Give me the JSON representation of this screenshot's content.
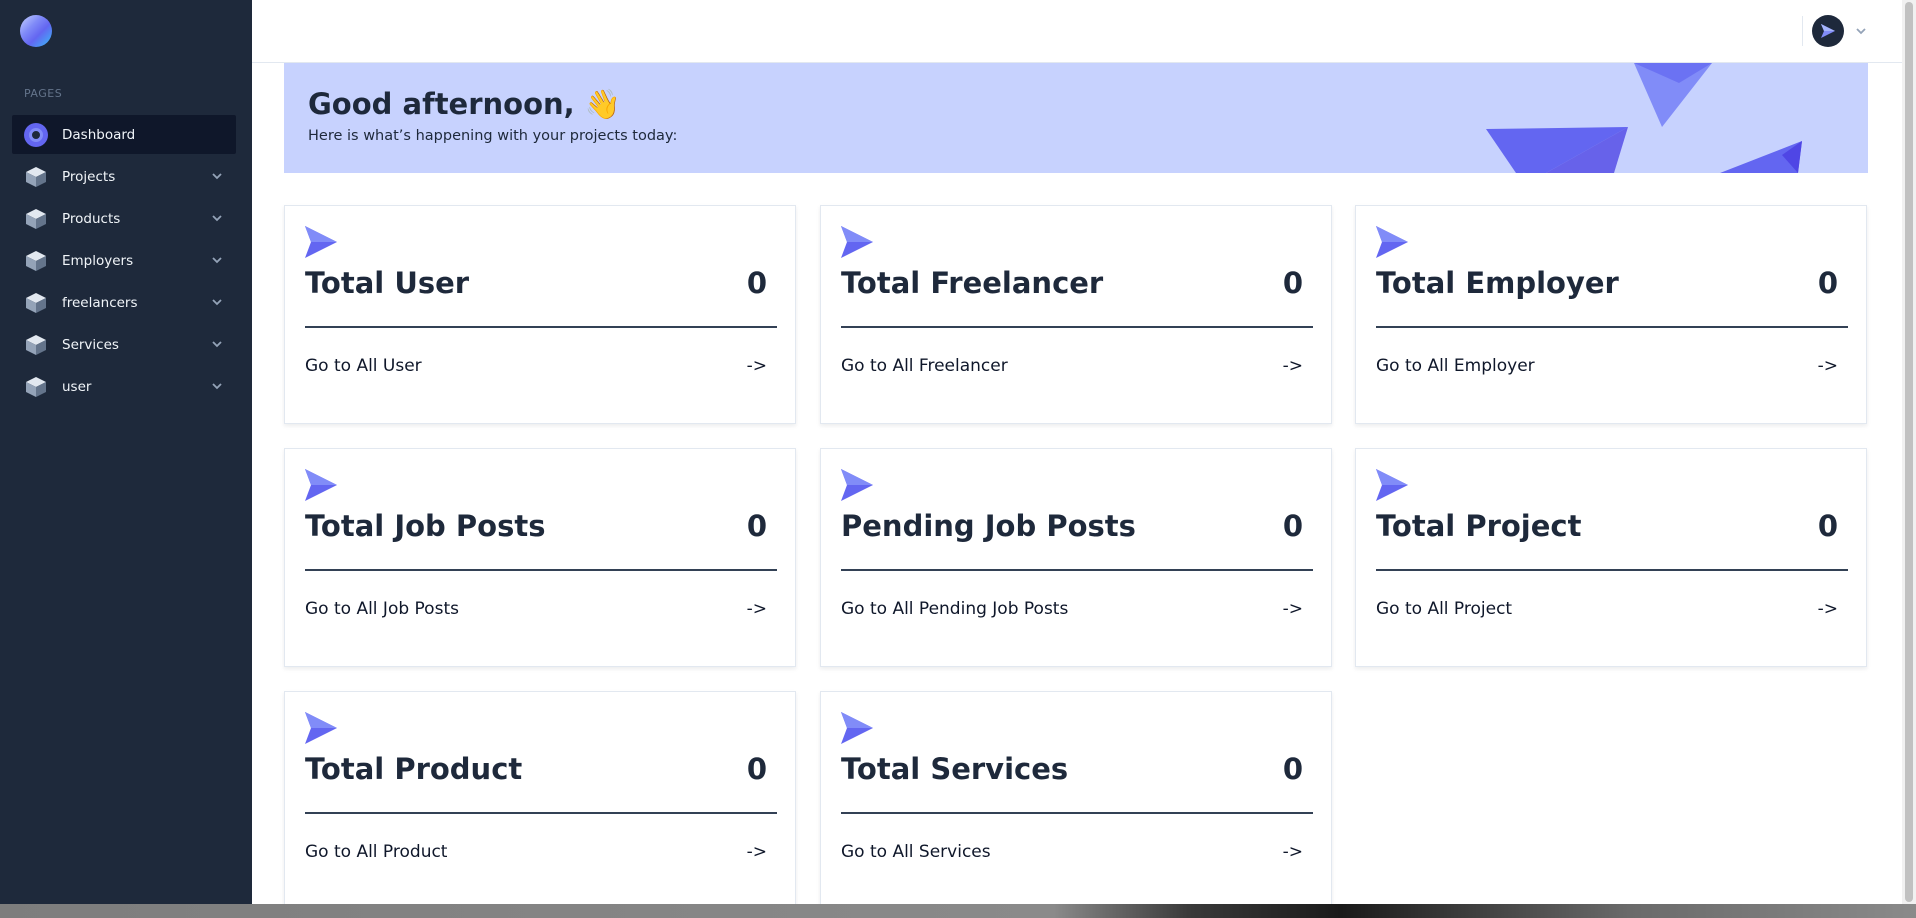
{
  "sidebar": {
    "section_label": "PAGES",
    "items": [
      {
        "label": "Dashboard",
        "icon": "dashboard-icon",
        "active": true
      },
      {
        "label": "Projects",
        "icon": "cube-icon",
        "expandable": true
      },
      {
        "label": "Products",
        "icon": "cube-icon",
        "expandable": true
      },
      {
        "label": "Employers",
        "icon": "cube-icon",
        "expandable": true
      },
      {
        "label": "freelancers",
        "icon": "cube-icon",
        "expandable": true
      },
      {
        "label": "Services",
        "icon": "cube-icon",
        "expandable": true
      },
      {
        "label": "user",
        "icon": "cube-icon",
        "expandable": true
      }
    ]
  },
  "header": {
    "avatar_icon": "paper-plane-icon"
  },
  "banner": {
    "greeting": "Good afternoon, 👋",
    "subtitle": "Here is what’s happening with your projects today:"
  },
  "cards": [
    {
      "title": "Total User",
      "value": "0",
      "link": "Go to All User",
      "arrow": "->"
    },
    {
      "title": "Total Freelancer",
      "value": "0",
      "link": "Go to All Freelancer",
      "arrow": "->"
    },
    {
      "title": "Total Employer",
      "value": "0",
      "link": "Go to All Employer",
      "arrow": "->"
    },
    {
      "title": "Total Job Posts",
      "value": "0",
      "link": "Go to All Job Posts",
      "arrow": "->"
    },
    {
      "title": "Pending Job Posts",
      "value": "0",
      "link": "Go to All Pending Job Posts",
      "arrow": "->"
    },
    {
      "title": "Total Project",
      "value": "0",
      "link": "Go to All Project",
      "arrow": "->"
    },
    {
      "title": "Total Product",
      "value": "0",
      "link": "Go to All Product",
      "arrow": "->"
    },
    {
      "title": "Total Services",
      "value": "0",
      "link": "Go to All Services",
      "arrow": "->"
    }
  ],
  "colors": {
    "sidebar_bg": "#1e293b",
    "active_item_bg": "#0f172a",
    "banner_bg": "#c7d2fe",
    "accent": "#6366f1"
  }
}
